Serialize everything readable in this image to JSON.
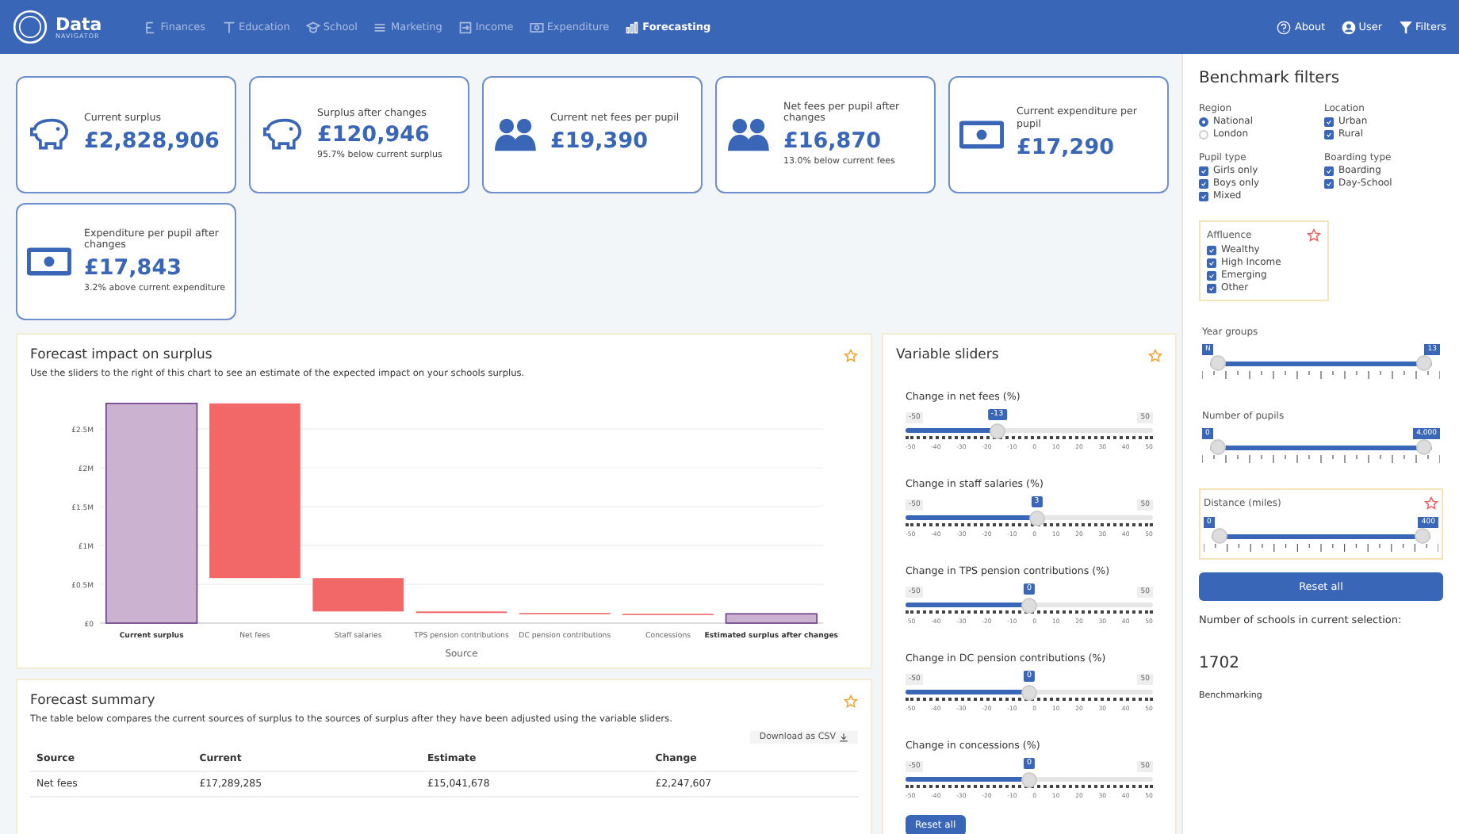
{
  "brand": {
    "name": "Data",
    "tagline": "NAVIGATOR"
  },
  "nav": [
    {
      "label": "Finances",
      "selected": false
    },
    {
      "label": "Education",
      "selected": false
    },
    {
      "label": "School",
      "selected": false
    },
    {
      "label": "Marketing",
      "selected": false
    },
    {
      "label": "Income",
      "selected": false
    },
    {
      "label": "Expenditure",
      "selected": false
    },
    {
      "label": "Forecasting",
      "selected": true
    }
  ],
  "nav_right": [
    {
      "label": "About"
    },
    {
      "label": "User"
    },
    {
      "label": "Filters"
    }
  ],
  "cards": [
    {
      "kind": "piggy",
      "label": "Current surplus",
      "value": "£2,828,906"
    },
    {
      "kind": "piggy",
      "label": "Surplus after changes",
      "value": "£120,946",
      "note": "95.7% below current surplus"
    },
    {
      "kind": "people",
      "label": "Current net fees per pupil",
      "value": "£19,390"
    },
    {
      "kind": "people",
      "label": "Net fees per pupil after changes",
      "value": "£16,870",
      "note": "13.0% below current fees"
    },
    {
      "kind": "money",
      "label": "Current expenditure per pupil",
      "value": "£17,290"
    },
    {
      "kind": "money",
      "label": "Expenditure per pupil after changes",
      "value": "£17,843",
      "note": "3.2% above current expenditure"
    }
  ],
  "impact": {
    "title": "Forecast impact on surplus",
    "description": "Use the sliders to the right of this chart to see an estimate of the expected impact on your schools surplus.",
    "waterfall": {
      "kind": "picture",
      "xlabel": "Source",
      "categories": [
        {
          "label": "Current surplus",
          "total": true
        },
        {
          "label": "Net fees",
          "total": false
        },
        {
          "label": "Staff salaries",
          "total": false
        },
        {
          "label": "TPS pension contributions",
          "total": false
        },
        {
          "label": "DC pension contributions",
          "total": false
        },
        {
          "label": "Concessions",
          "total": false
        },
        {
          "label": "Estimated surplus after changes",
          "total": true
        }
      ],
      "yticks": [
        "£2.5M",
        "£2M",
        "£1.5M",
        "£1M",
        "£0.5M",
        "£0"
      ]
    }
  },
  "summary": {
    "title": "Forecast summary",
    "description": "The table below compares the current sources of surplus to the sources of surplus after they have been adjusted using the variable sliders.",
    "download": "Download as CSV",
    "columns": [
      "Source",
      "Current",
      "Estimate",
      "Change"
    ],
    "rows": [
      [
        "Net fees",
        "£17,289,285",
        "£15,041,678",
        "£2,247,607"
      ]
    ]
  },
  "sliders": {
    "title": "Variable sliders",
    "reset": "Reset all",
    "items": [
      {
        "label": "Change in net fees (%)",
        "value": "-13",
        "level": 0.37,
        "min": "-50",
        "max": "50",
        "ticks": [
          "-50",
          "-40",
          "-30",
          "-20",
          "-10",
          "0",
          "10",
          "20",
          "30",
          "40",
          "50"
        ]
      },
      {
        "label": "Change in staff salaries (%)",
        "value": "3",
        "level": 0.53,
        "min": "-50",
        "max": "50",
        "ticks": [
          "-50",
          "-40",
          "-30",
          "-20",
          "-10",
          "0",
          "10",
          "20",
          "30",
          "40",
          "50"
        ]
      },
      {
        "label": "Change in TPS pension contributions (%)",
        "value": "0",
        "level": 0.5,
        "min": "-50",
        "max": "50",
        "ticks": [
          "-50",
          "-40",
          "-30",
          "-20",
          "-10",
          "0",
          "10",
          "20",
          "30",
          "40",
          "50"
        ]
      },
      {
        "label": "Change in DC pension contributions (%)",
        "value": "0",
        "level": 0.5,
        "min": "-50",
        "max": "50",
        "ticks": [
          "-50",
          "-40",
          "-30",
          "-20",
          "-10",
          "0",
          "10",
          "20",
          "30",
          "40",
          "50"
        ]
      },
      {
        "label": "Change in concessions (%)",
        "value": "0",
        "level": 0.5,
        "min": "-50",
        "max": "50",
        "ticks": [
          "-50",
          "-40",
          "-30",
          "-20",
          "-10",
          "0",
          "10",
          "20",
          "30",
          "40",
          "50"
        ]
      }
    ]
  },
  "filters": {
    "title": "Benchmark filters",
    "groups": [
      {
        "label": "Region",
        "kind": "radio",
        "options": [
          {
            "label": "National",
            "selected": true
          },
          {
            "label": "London",
            "selected": false
          }
        ]
      },
      {
        "label": "Location",
        "kind": "check",
        "options": [
          {
            "label": "Urban",
            "checked": true
          },
          {
            "label": "Rural",
            "checked": true
          }
        ]
      },
      {
        "label": "Pupil type",
        "kind": "check",
        "options": [
          {
            "label": "Girls only",
            "checked": true
          },
          {
            "label": "Boys only",
            "checked": true
          },
          {
            "label": "Mixed",
            "checked": true
          }
        ]
      },
      {
        "label": "Boarding type",
        "kind": "check",
        "options": [
          {
            "label": "Boarding",
            "checked": true
          },
          {
            "label": "Day-School",
            "checked": true
          }
        ]
      }
    ],
    "affluence": {
      "label": "Affluence",
      "options": [
        {
          "label": "Wealthy",
          "checked": true
        },
        {
          "label": "High Income",
          "checked": true
        },
        {
          "label": "Emerging",
          "checked": true
        },
        {
          "label": "Other",
          "checked": true
        }
      ]
    },
    "ranges": [
      {
        "label": "Year groups",
        "from": "N",
        "to": "13",
        "boxed": false
      },
      {
        "label": "Number of pupils",
        "from": "0",
        "to": "4,000",
        "boxed": false
      },
      {
        "label": "Distance (miles)",
        "from": "0",
        "to": "400",
        "boxed": true
      }
    ],
    "reset": "Reset all",
    "count_label": "Number of schools in current selection:",
    "count": "1702",
    "footer": "Benchmarking"
  }
}
